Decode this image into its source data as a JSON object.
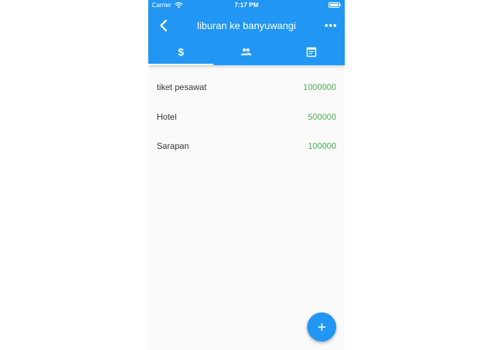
{
  "status": {
    "carrier": "Carrier",
    "time": "7:17 PM"
  },
  "appbar": {
    "title": "liburan ke banyuwangi",
    "color": "#2196f3",
    "back_icon": "chevron-left-icon",
    "more_icon": "more-horiz-icon"
  },
  "tabs": [
    {
      "icon": "dollar-icon",
      "selected": true
    },
    {
      "icon": "people-icon",
      "selected": false
    },
    {
      "icon": "calendar-icon",
      "selected": false
    }
  ],
  "expenses": [
    {
      "label": "tiket pesawat",
      "amount": "1000000"
    },
    {
      "label": "Hotel",
      "amount": "500000"
    },
    {
      "label": "Sarapan",
      "amount": "100000"
    }
  ],
  "amount_color": "#4caf50",
  "fab": {
    "label": "+",
    "icon": "add-icon"
  }
}
